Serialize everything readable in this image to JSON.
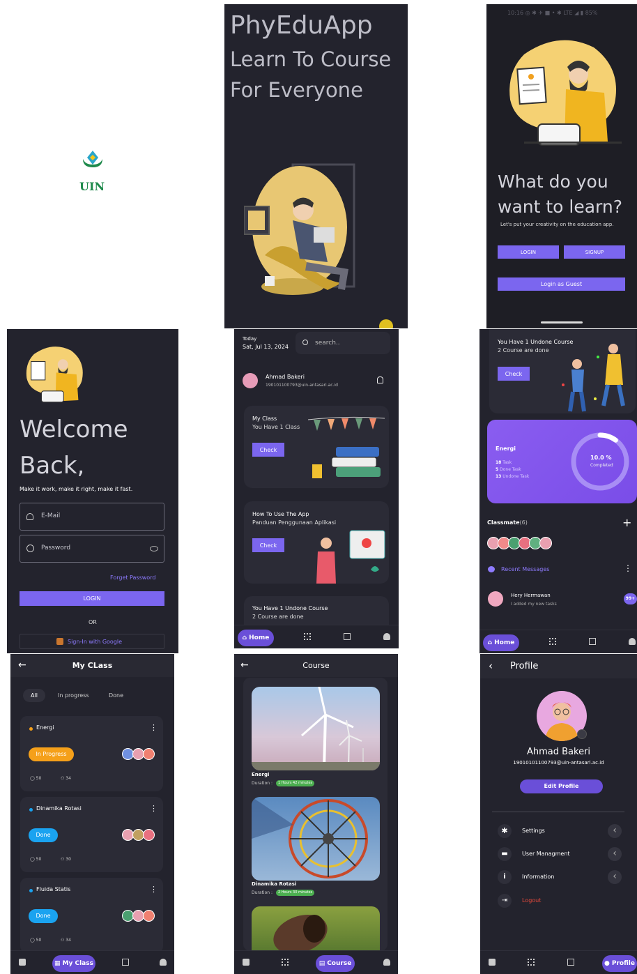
{
  "splash": {
    "logo_text": "UIN"
  },
  "intro": {
    "line1": "PhyEduApp",
    "line2": "Learn To Course",
    "line3": "For Everyone"
  },
  "welcome": {
    "status": "10:16  ◎ ✱ ✈ ■ •       ✱ LTE ◢ ▮ 85%",
    "title_line1": "What do you",
    "title_line2": "want to learn?",
    "subtitle": "Let's put your creativity on the education app.",
    "login": "LOGIN",
    "signup": "SIGNUP",
    "guest": "Login as Guest"
  },
  "login": {
    "title_line1": "Welcome",
    "title_line2": "Back,",
    "subtitle": "Make it work, make it right, make it fast.",
    "email_placeholder": "E-Mail",
    "password_placeholder": "Password",
    "forget": "Forget Password",
    "login": "LOGIN",
    "or": "OR",
    "google": "Sign-In with Google"
  },
  "home": {
    "today": "Today",
    "date": "Sat, Jul 13, 2024",
    "search_placeholder": "search..",
    "user_name": "Ahmad Bakeri",
    "user_email": "190101100793@uin-antasari.ac.id",
    "card1_title": "My Class",
    "card1_sub": "You Have 1 Class",
    "card1_btn": "Check",
    "card2_title": "How To Use The App",
    "card2_sub": "Panduan Penggunaan Aplikasi",
    "card2_btn": "Check",
    "card3_title": "You Have 1 Undone Course",
    "card3_sub": "2 Course are done",
    "nav_home": "Home"
  },
  "home2": {
    "undone_title": "You Have 1 Undone Course",
    "undone_sub": "2 Course are done",
    "check": "Check",
    "energi": "Energi",
    "task_n": "18",
    "task_l": "Task",
    "done_n": "5",
    "done_l": "Done Task",
    "undone_n": "13",
    "undone_l": "Undone Task",
    "progress_value": "10.0 %",
    "progress_label": "Completed",
    "progress_fraction": 0.1,
    "classmate": "Classmate",
    "classmate_count": "(6)",
    "recent": "Recent Messages",
    "msg_name": "Hery Hermawan",
    "msg_text": "I added my new tasks",
    "msg_badge": "99+",
    "nav_home": "Home"
  },
  "myclass": {
    "title": "My CLass",
    "tab_all": "All",
    "tab_progress": "In progress",
    "tab_done": "Done",
    "classes": [
      {
        "name": "Energi",
        "status": "In Progress",
        "comments": "50",
        "members": "34"
      },
      {
        "name": "Dinamika Rotasi",
        "status": "Done",
        "comments": "50",
        "members": "30"
      },
      {
        "name": "Fluida Statis",
        "status": "Done",
        "comments": "50",
        "members": "34"
      }
    ],
    "nav_label": "My Class"
  },
  "course": {
    "title": "Course",
    "items": [
      {
        "name": "Energi",
        "duration_label": "Duration :",
        "duration": "1 Hours 42 minutes"
      },
      {
        "name": "Dinamika Rotasi",
        "duration_label": "Duration :",
        "duration": "2 Hours 30 minutes"
      }
    ],
    "nav_label": "Course"
  },
  "profile": {
    "title": "Profile",
    "name": "Ahmad Bakeri",
    "email": "19010101100793@uin-antasari.ac.id",
    "edit": "Edit Profile",
    "settings": "Settings",
    "user_mgmt": "User Managment",
    "information": "Information",
    "logout": "Logout",
    "nav_label": "Profile"
  },
  "colors": {
    "bg": "#23232d",
    "card": "#2b2b36",
    "accent": "#7b66ef",
    "orange": "#f5a01a",
    "blue": "#1aa3f0",
    "logout": "#e84a3c"
  }
}
